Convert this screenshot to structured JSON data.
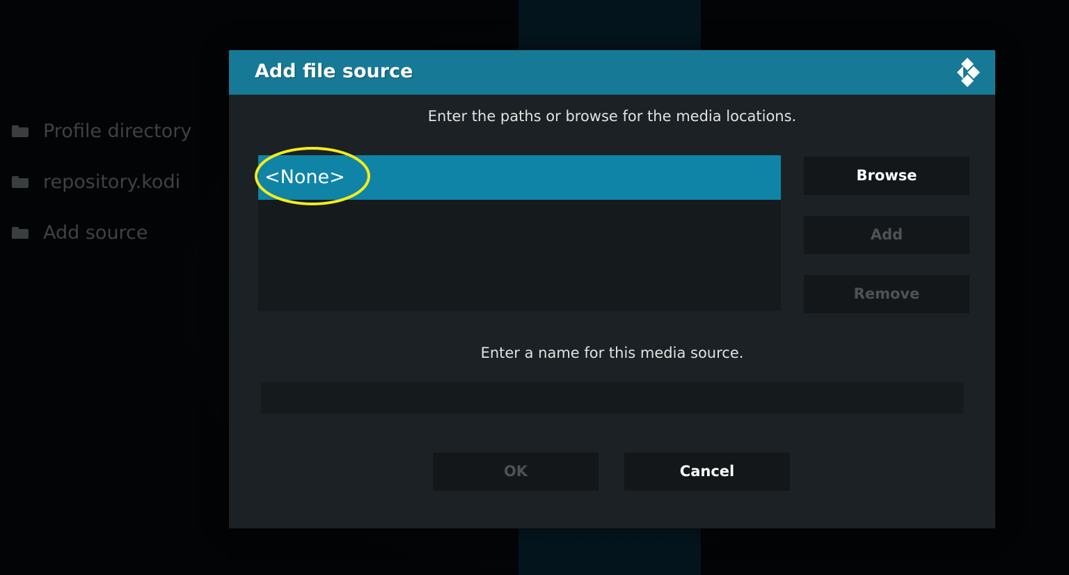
{
  "background_list": {
    "items": [
      {
        "label": "Profile directory",
        "icon": "folder-icon"
      },
      {
        "label": "repository.kodi",
        "icon": "folder-icon"
      },
      {
        "label": "Add source",
        "icon": "folder-icon"
      }
    ]
  },
  "dialog": {
    "title": "Add file source",
    "logo_icon": "kodi-logo-icon",
    "paths_prompt": "Enter the paths or browse for the media locations.",
    "paths": [
      {
        "value": "<None>",
        "selected": true
      }
    ],
    "buttons": {
      "browse": "Browse",
      "add": "Add",
      "remove": "Remove"
    },
    "name_prompt": "Enter a name for this media source.",
    "name_value": "",
    "footer": {
      "ok": "OK",
      "cancel": "Cancel"
    }
  },
  "colors": {
    "header": "#167a96",
    "selected_row": "#0f84a7",
    "annotation_ring": "#f4ec1c",
    "dialog_bg": "#1b2124"
  }
}
